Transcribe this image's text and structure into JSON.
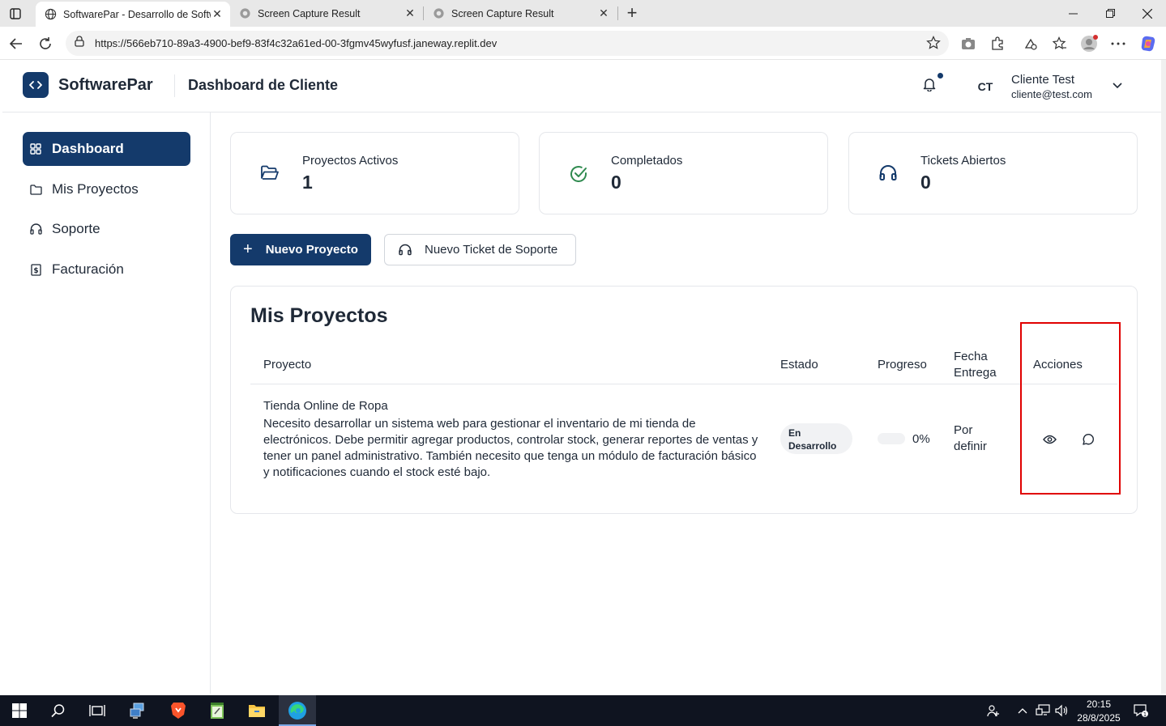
{
  "browser": {
    "tabs": [
      {
        "title": "SoftwarePar - Desarrollo de Software",
        "icon": "globe-icon",
        "active": true
      },
      {
        "title": "Screen Capture Result",
        "icon": "camera-icon",
        "active": false
      },
      {
        "title": "Screen Capture Result",
        "icon": "camera-icon",
        "active": false
      }
    ],
    "url": "https://566eb710-89a3-4900-bef9-83f4c32a61ed-00-3fgmv45wyfusf.janeway.replit.dev"
  },
  "header": {
    "brand": "SoftwarePar",
    "title": "Dashboard de Cliente",
    "avatar_initials": "CT",
    "user_name": "Cliente Test",
    "user_email": "cliente@test.com"
  },
  "sidebar": {
    "items": [
      {
        "label": "Dashboard",
        "icon": "grid-icon",
        "active": true
      },
      {
        "label": "Mis Proyectos",
        "icon": "folder-icon",
        "active": false
      },
      {
        "label": "Soporte",
        "icon": "headphones-icon",
        "active": false
      },
      {
        "label": "Facturación",
        "icon": "receipt-icon",
        "active": false
      }
    ]
  },
  "stats": [
    {
      "label": "Proyectos Activos",
      "value": "1",
      "icon": "folder-open-icon"
    },
    {
      "label": "Completados",
      "value": "0",
      "icon": "check-circle-icon"
    },
    {
      "label": "Tickets Abiertos",
      "value": "0",
      "icon": "headphones-icon"
    }
  ],
  "actions": {
    "new_project": "Nuevo Proyecto",
    "new_ticket": "Nuevo Ticket de Soporte"
  },
  "projects": {
    "title": "Mis Proyectos",
    "columns": [
      "Proyecto",
      "Estado",
      "Progreso",
      "Fecha Entrega",
      "Acciones"
    ],
    "rows": [
      {
        "name": "Tienda Online de Ropa",
        "description": "Necesito desarrollar un sistema web para gestionar el inventario de mi tienda de electrónicos. Debe permitir agregar productos, controlar stock, generar reportes de ventas y tener un panel administrativo. También necesito que tenga un módulo de facturación básico y notificaciones cuando el stock esté bajo.",
        "status": "En Desarrollo",
        "progress": 0,
        "progress_label": "0%",
        "due_date": "Por definir"
      }
    ]
  },
  "colors": {
    "primary": "#143a6b",
    "success": "#2f8a4f",
    "highlight": "#e00000"
  },
  "taskbar": {
    "time": "20:15",
    "date": "28/8/2025",
    "notification_count": "1"
  }
}
